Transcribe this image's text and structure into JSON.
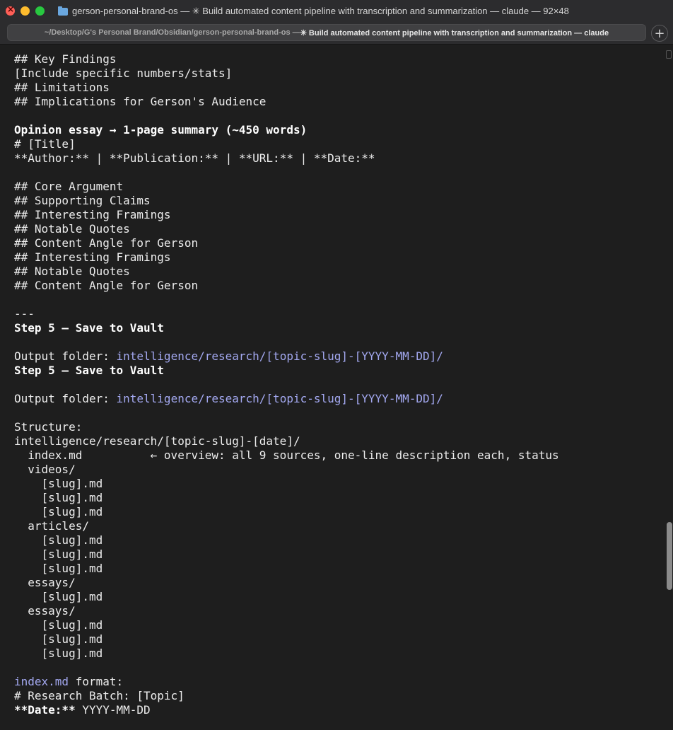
{
  "window": {
    "title": "gerson-personal-brand-os — ✳ Build automated content pipeline with transcription and summarization — claude — 92×48",
    "tab_dir": "~/Desktop/G's Personal Brand/Obsidian/gerson-personal-brand-os — ",
    "tab_title": "✳ Build automated content pipeline with transcription and summarization — claude",
    "new_tab_label": "+"
  },
  "terminal": {
    "lines": {
      "l0": "## Key Findings",
      "l1": "[Include specific numbers/stats]",
      "l2": "## Limitations",
      "l3": "## Implications for Gerson's Audience",
      "l4": "",
      "l5": "Opinion essay → 1-page summary (~450 words)",
      "l6": "# [Title]",
      "l7": "**Author:** | **Publication:** | **URL:** | **Date:**",
      "l8": "",
      "l9": "## Core Argument",
      "l10": "## Supporting Claims",
      "l11": "## Interesting Framings",
      "l12": "## Notable Quotes",
      "l13": "## Content Angle for Gerson",
      "l14": "## Interesting Framings",
      "l15": "## Notable Quotes",
      "l16": "## Content Angle for Gerson",
      "l17": "",
      "l18": "---",
      "l19": "Step 5 — Save to Vault",
      "l20": "",
      "l21_label": "Output folder: ",
      "l21_path": "intelligence/research/[topic-slug]-[YYYY-MM-DD]/",
      "l22": "Step 5 — Save to Vault",
      "l23": "",
      "l24_label": "Output folder: ",
      "l24_path": "intelligence/research/[topic-slug]-[YYYY-MM-DD]/",
      "l25": "",
      "l26": "Structure:",
      "l27": "intelligence/research/[topic-slug]-[date]/",
      "l28": "  index.md          ← overview: all 9 sources, one-line description each, status",
      "l29": "  videos/",
      "l30": "    [slug].md",
      "l31": "    [slug].md",
      "l32": "    [slug].md",
      "l33": "  articles/",
      "l34": "    [slug].md",
      "l35": "    [slug].md",
      "l36": "    [slug].md",
      "l37": "  essays/",
      "l38": "    [slug].md",
      "l39": "  essays/",
      "l40": "    [slug].md",
      "l41": "    [slug].md",
      "l42": "    [slug].md",
      "l43": "",
      "l44_link": "index.md",
      "l44_rest": " format:",
      "l45": "# Research Batch: [Topic]",
      "l46_bold": "**Date:**",
      "l46_rest": " YYYY-MM-DD"
    }
  },
  "colors": {
    "background": "#1e1e1e",
    "text": "#ececec",
    "link": "#a3a8f0"
  }
}
